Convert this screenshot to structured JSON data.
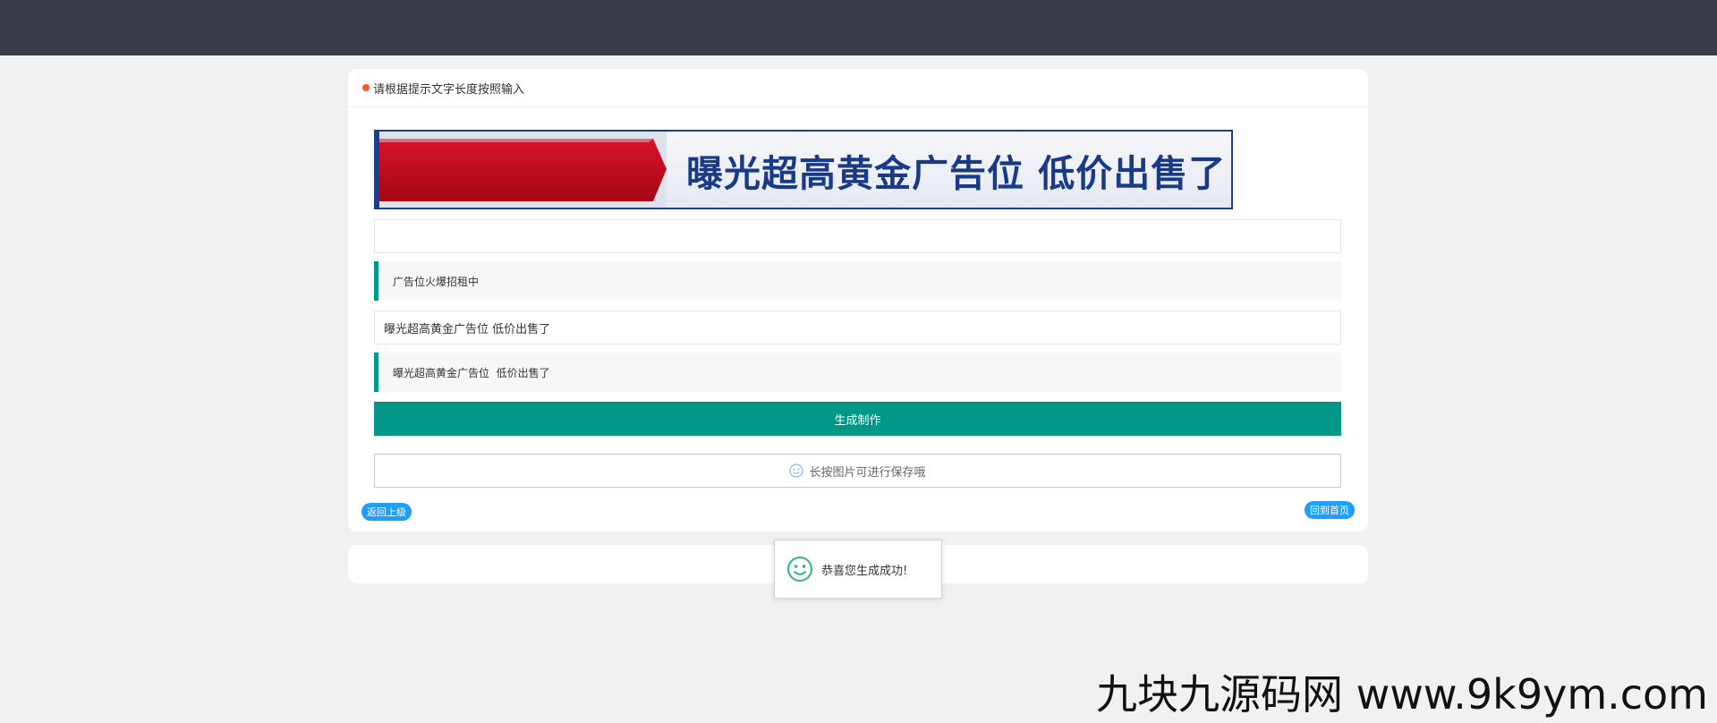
{
  "header": {
    "notice": "请根据提示文字长度按照输入"
  },
  "banner": {
    "text": "曝光超高黄金广告位 低价出售了",
    "colors": {
      "border": "#1c3f8a",
      "text": "#193a86",
      "arrow": "#b8091c"
    }
  },
  "form": {
    "input1_value": "",
    "quote1": "广告位火爆招租中",
    "input2_value": "曝光超高黄金广告位 低价出售了",
    "quote2": "曝光超高黄金广告位  低价出售了",
    "generate_label": "生成制作",
    "save_tip": "长按图片可进行保存哦"
  },
  "nav": {
    "back_label": "返回上级",
    "home_label": "回到首页"
  },
  "toast": {
    "message": "恭喜您生成成功!"
  },
  "watermark": {
    "text": "九块九源码网 www.9k9ym.com"
  },
  "colors": {
    "topbar": "#393d49",
    "accent": "#009688",
    "pill": "#1e9fff",
    "dot": "#ff5722"
  },
  "icons": {
    "smile": "smile-icon"
  }
}
